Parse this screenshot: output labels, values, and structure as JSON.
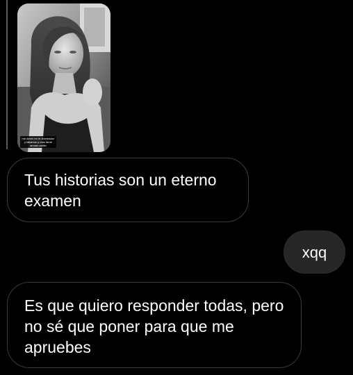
{
  "story_reply": {
    "caption": "me dormí en el dormitador y fallamos y mas tarde amoan aniiiin"
  },
  "messages": [
    {
      "direction": "incoming",
      "text": "Tus historias son un eterno examen"
    },
    {
      "direction": "outgoing",
      "text": "xqq"
    },
    {
      "direction": "incoming",
      "text": "Es que quiero responder todas, pero no sé que poner para que me apruebes"
    }
  ],
  "colors": {
    "background": "#000000",
    "incoming_bubble_border": "#3a3a3a",
    "outgoing_bubble": "#262626",
    "text": "#ffffff"
  },
  "icons": {
    "story_thumbnail": "photo-thumbnail"
  }
}
